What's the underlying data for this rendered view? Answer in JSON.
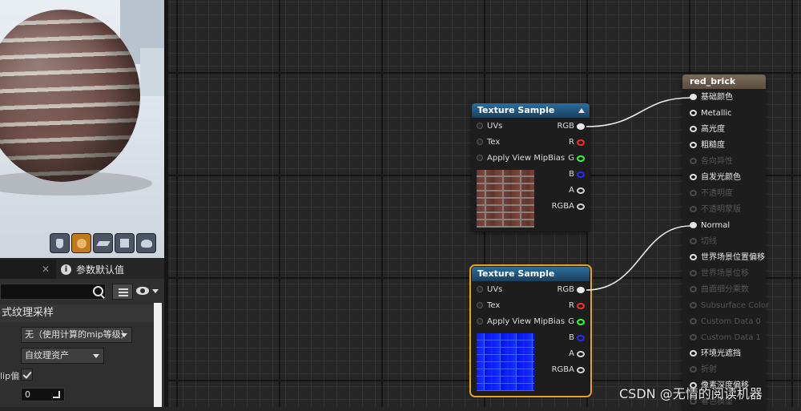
{
  "details": {
    "tabs": [
      {
        "label": "参数默认值",
        "icon": "info-icon"
      }
    ],
    "search": {
      "value": "",
      "placeholder": ""
    },
    "section_title": "式纹理采样",
    "properties": [
      {
        "label": "",
        "value": "无（使用计算的mip等级）",
        "type": "dropdown"
      },
      {
        "label": "",
        "value": "自纹理资产",
        "type": "dropdown"
      },
      {
        "label": "lip偏",
        "value": true,
        "type": "checkbox"
      },
      {
        "label": "",
        "value": "0",
        "type": "number"
      }
    ]
  },
  "preview_toolbar": {
    "buttons": [
      "cylinder-icon",
      "sphere-icon",
      "plane-icon",
      "cube-icon",
      "teapot-icon"
    ],
    "active": "sphere-icon"
  },
  "nodes": [
    {
      "title": "Texture Sample",
      "inputs": [
        "UVs",
        "Tex",
        "Apply View MipBias"
      ],
      "outputs": [
        "RGB",
        "R",
        "G",
        "B",
        "A",
        "RGBA"
      ],
      "texture": "brick",
      "selected": false
    },
    {
      "title": "Texture Sample",
      "inputs": [
        "UVs",
        "Tex",
        "Apply View MipBias"
      ],
      "outputs": [
        "RGB",
        "R",
        "G",
        "B",
        "A",
        "RGBA"
      ],
      "texture": "normal",
      "selected": true
    }
  ],
  "material": {
    "title": "red_brick",
    "pins": [
      {
        "label": "基础颜色",
        "enabled": true,
        "linked": true
      },
      {
        "label": "Metallic",
        "enabled": true,
        "linked": false
      },
      {
        "label": "高光度",
        "enabled": true,
        "linked": false
      },
      {
        "label": "粗糙度",
        "enabled": true,
        "linked": false
      },
      {
        "label": "各向异性",
        "enabled": false,
        "linked": false
      },
      {
        "label": "自发光颜色",
        "enabled": true,
        "linked": false
      },
      {
        "label": "不透明度",
        "enabled": false,
        "linked": false
      },
      {
        "label": "不透明蒙版",
        "enabled": false,
        "linked": false
      },
      {
        "label": "Normal",
        "enabled": true,
        "linked": true
      },
      {
        "label": "切线",
        "enabled": false,
        "linked": false
      },
      {
        "label": "世界场景位置偏移",
        "enabled": true,
        "linked": false
      },
      {
        "label": "世界场景位移",
        "enabled": false,
        "linked": false
      },
      {
        "label": "曲面细分乘数",
        "enabled": false,
        "linked": false
      },
      {
        "label": "Subsurface Color",
        "enabled": false,
        "linked": false
      },
      {
        "label": "Custom Data 0",
        "enabled": false,
        "linked": false
      },
      {
        "label": "Custom Data 1",
        "enabled": false,
        "linked": false
      },
      {
        "label": "环境光遮挡",
        "enabled": true,
        "linked": false
      },
      {
        "label": "折射",
        "enabled": false,
        "linked": false
      },
      {
        "label": "像素深度偏移",
        "enabled": true,
        "linked": false
      },
      {
        "label": "着色模型",
        "enabled": false,
        "linked": false
      }
    ]
  },
  "watermark": "CSDN @无情的阅读机器",
  "colors": {
    "accent_selected": "#e8a21e",
    "node_header": "#2a6ea0",
    "material_header": "#7a6a58"
  }
}
